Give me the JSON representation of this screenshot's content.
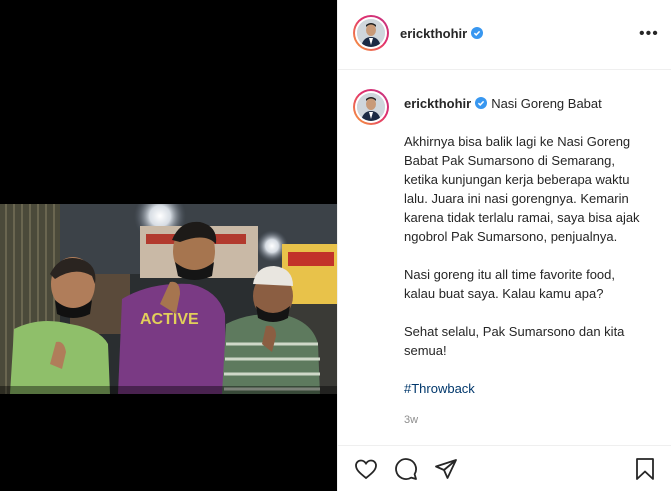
{
  "media": {
    "alt": "photo"
  },
  "header": {
    "username": "erickthohir",
    "verified": true,
    "more_label": "•••"
  },
  "caption": {
    "username": "erickthohir",
    "title": "Nasi Goreng Babat",
    "paragraphs": [
      "Akhirnya bisa balik lagi ke Nasi Goreng Babat Pak Sumarsono di Semarang, ketika kunjungan kerja beberapa waktu lalu. Juara ini nasi gorengnya. Kemarin karena tidak terlalu ramai, saya bisa ajak ngobrol Pak Sumarsono, penjualnya.",
      "Nasi goreng itu all time favorite food, kalau buat saya. Kalau kamu apa?",
      "Sehat selalu, Pak Sumarsono dan kita semua!"
    ],
    "hashtag": "#Throwback",
    "age": "3w"
  },
  "actions": {
    "icons": [
      "heart-icon",
      "comment-icon",
      "share-icon",
      "bookmark-icon"
    ]
  },
  "colors": {
    "text": "#262626",
    "secondary": "#8e8e8e",
    "hashtag": "#00376b",
    "verified": "#3897f0",
    "border": "#efefef",
    "media_bg": "#000000"
  }
}
